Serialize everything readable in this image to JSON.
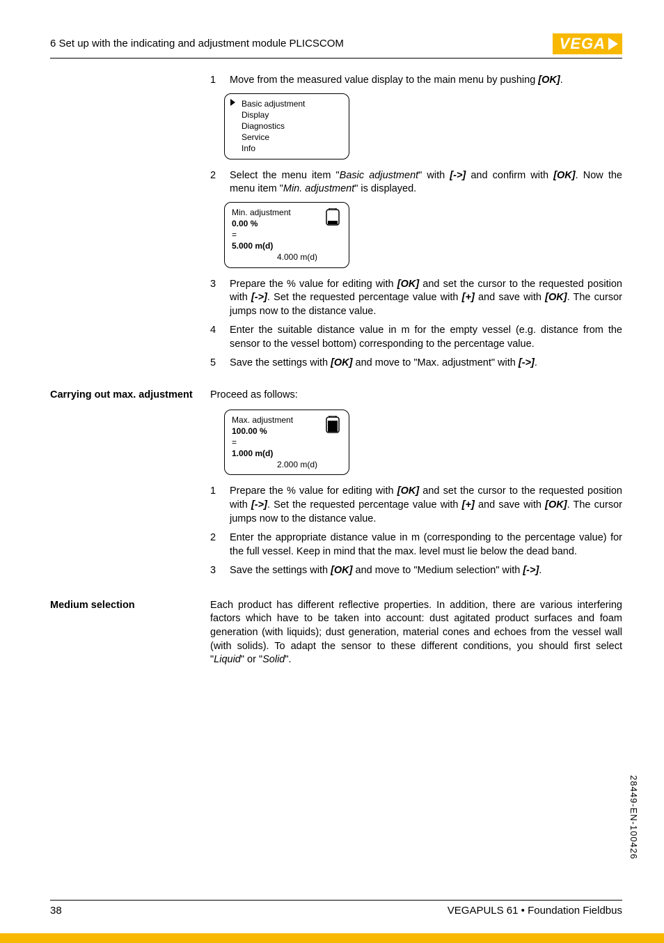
{
  "header": {
    "section": "6   Set up with the indicating and adjustment module PLICSCOM",
    "logo_text": "VEGA"
  },
  "block1": {
    "steps": [
      {
        "n": "1",
        "t1": "Move from the measured value display to the main menu by pushing ",
        "k1": "[OK]",
        "t2": "."
      }
    ]
  },
  "menu_display": {
    "items": [
      "Basic adjustment",
      "Display",
      "Diagnostics",
      "Service",
      "Info"
    ]
  },
  "block2": {
    "n": "2",
    "t1": "Select the menu item \"",
    "i1": "Basic adjustment",
    "t2": "\" with ",
    "k1": "[->]",
    "t3": " and confirm with ",
    "k2": "[OK]",
    "t4": ". Now the menu item \"",
    "i2": "Min. adjustment",
    "t5": "\" is displayed."
  },
  "min_display": {
    "title": "Min. adjustment",
    "percent": "0.00 %",
    "eq": "=",
    "dist1": "5.000 m(d)",
    "dist2": "4.000 m(d)"
  },
  "block3": {
    "s3": {
      "n": "3",
      "t1": "Prepare the % value for editing with ",
      "k1": "[OK]",
      "t2": " and set the cursor to the requested position with ",
      "k2": "[->]",
      "t3": ". Set the requested percentage value with ",
      "k3": "[+]",
      "t4": " and save with ",
      "k4": "[OK]",
      "t5": ". The cursor jumps now to the distance value."
    },
    "s4": {
      "n": "4",
      "t": "Enter the suitable distance value in m for the empty vessel (e.g. distance from the sensor to the vessel bottom) corresponding to the percentage value."
    },
    "s5": {
      "n": "5",
      "t1": "Save the settings with ",
      "k1": "[OK]",
      "t2": " and move to \"Max. adjustment\" with ",
      "k2": "[->]",
      "t3": "."
    }
  },
  "max_section": {
    "heading": "Carrying out max. adjustment",
    "intro": "Proceed as follows:"
  },
  "max_display": {
    "title": "Max. adjustment",
    "percent": "100.00 %",
    "eq": "=",
    "dist1": "1.000 m(d)",
    "dist2": "2.000 m(d)"
  },
  "block4": {
    "s1": {
      "n": "1",
      "t1": "Prepare the % value for editing with ",
      "k1": "[OK]",
      "t2": " and set the cursor to the requested position with ",
      "k2": "[->]",
      "t3": ". Set the requested percentage value with ",
      "k3": "[+]",
      "t4": " and save with ",
      "k4": "[OK]",
      "t5": ". The cursor jumps now to the distance value."
    },
    "s2": {
      "n": "2",
      "t": "Enter the appropriate distance value in m (corresponding to the percentage value) for the full vessel. Keep in mind that the max. level must lie below the dead band."
    },
    "s3": {
      "n": "3",
      "t1": "Save the settings with ",
      "k1": "[OK]",
      "t2": " and move to \"Medium selection\" with ",
      "k2": "[->]",
      "t3": "."
    }
  },
  "medium": {
    "heading": "Medium selection",
    "t1": "Each product has different reflective properties. In addition, there are various interfering factors which have to be taken into account: dust agitated product surfaces and foam generation (with liquids); dust generation, material cones and echoes from the vessel wall (with solids). To adapt the sensor to these different conditions, you should first select \"",
    "i1": "Liquid",
    "t2": "\" or \"",
    "i2": "Solid",
    "t3": "\"."
  },
  "footer": {
    "page": "38",
    "product": "VEGAPULS 61 • Foundation Fieldbus",
    "docid": "28449-EN-100426"
  }
}
